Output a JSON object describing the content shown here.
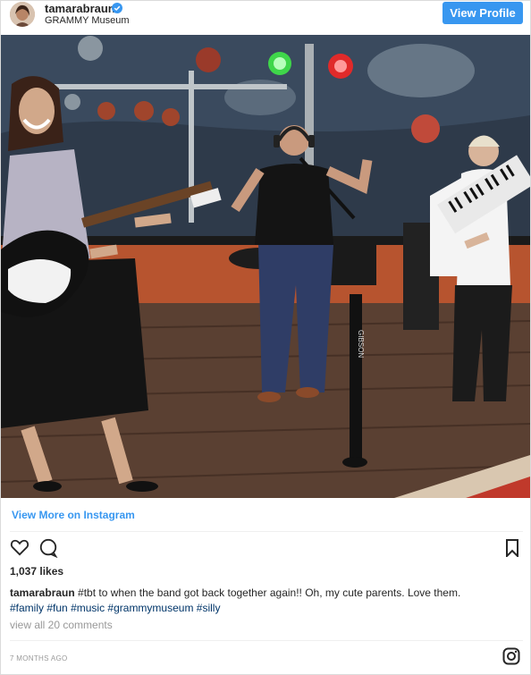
{
  "header": {
    "username": "tamarabraun",
    "location": "GRAMMY Museum",
    "view_profile_label": "View Profile"
  },
  "photo": {
    "description_icon": "photo-band-performance",
    "banner_text": "GIBSON"
  },
  "footer": {
    "view_more_label": "View More on Instagram",
    "likes": "1,037 likes",
    "caption_user": "tamarabraun",
    "caption_text": " #tbt to when the band got back together again!! Oh, my cute parents. Love them.",
    "hashtags": [
      "#family",
      "#fun",
      "#music",
      "#grammymuseum",
      "#silly"
    ],
    "comments_link": "view all 20 comments",
    "timestamp": "7 MONTHS AGO"
  },
  "icons": {
    "like": "heart-icon",
    "comment": "comment-icon",
    "save": "bookmark-icon",
    "instagram": "instagram-icon"
  },
  "colors": {
    "accent": "#3897f0",
    "hashtag": "#003569",
    "muted": "#999999"
  }
}
